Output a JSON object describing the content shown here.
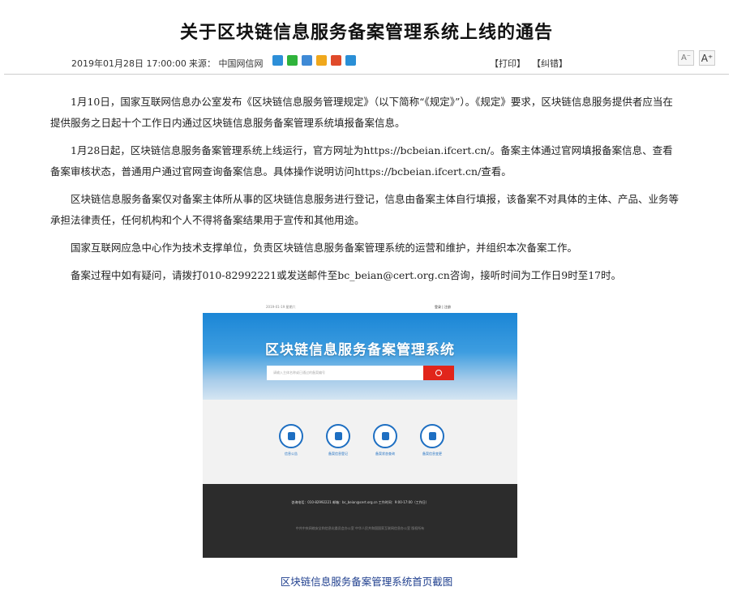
{
  "article": {
    "title": "关于区块链信息服务备案管理系统上线的通告",
    "date": "2019年01月28日 17:00:00",
    "source": "来源： 中国网信网",
    "print_label": "【打印】",
    "correct_label": "【纠错】",
    "font_small_label": "A⁻",
    "font_large_label": "A⁺",
    "share_icons": [
      {
        "name": "qzone-share-icon",
        "color": "#2d8fd8"
      },
      {
        "name": "wechat-share-icon",
        "color": "#2fb33b"
      },
      {
        "name": "tencent-weibo-share-icon",
        "color": "#3f8ad6"
      },
      {
        "name": "qq-share-icon",
        "color": "#f0a81c"
      },
      {
        "name": "weibo-share-icon",
        "color": "#e04a2a"
      },
      {
        "name": "people-share-icon",
        "color": "#2a8fd6"
      }
    ],
    "paragraphs": [
      "1月10日，国家互联网信息办公室发布《区块链信息服务管理规定》（以下简称“《规定》”）。《规定》要求，区块链信息服务提供者应当在提供服务之日起十个工作日内通过区块链信息服务备案管理系统填报备案信息。",
      "1月28日起，区块链信息服务备案管理系统上线运行，官方网址为https://bcbeian.ifcert.cn/。备案主体通过官网填报备案信息、查看备案审核状态，普通用户通过官网查询备案信息。具体操作说明访问https://bcbeian.ifcert.cn/查看。",
      "区块链信息服务备案仅对备案主体所从事的区块链信息服务进行登记，信息由备案主体自行填报，该备案不对具体的主体、产品、业务等承担法律责任，任何机构和个人不得将备案结果用于宣传和其他用途。",
      "国家互联网应急中心作为技术支撑单位，负责区块链信息服务备案管理系统的运营和维护，并组织本次备案工作。",
      "备案过程中如有疑问，请拨打010-82992221或发送邮件至bc_beian@cert.org.cn咨询，接听时间为工作日9时至17时。"
    ],
    "caption": "区块链信息服务备案管理系统首页截图"
  },
  "screenshot": {
    "top_date": "2019-01-19  星期六",
    "top_links": "登录 | 注册",
    "system_name": "区块链信息服务备案管理系统",
    "search_placeholder": "请输入主体名称或已通过的备案编号",
    "tiles": [
      "信息公告",
      "备案信息登记",
      "备案状态查询",
      "备案信息变更"
    ],
    "footer_contact": "咨询电话：010-82992221    邮箱：bc_beian@cert.org.cn    工作时间：9:00-17:00（工作日）",
    "footer_copyright": "中共中央网络安全和信息化委员会办公室  中华人民共和国国家互联网信息办公室 版权所有"
  }
}
